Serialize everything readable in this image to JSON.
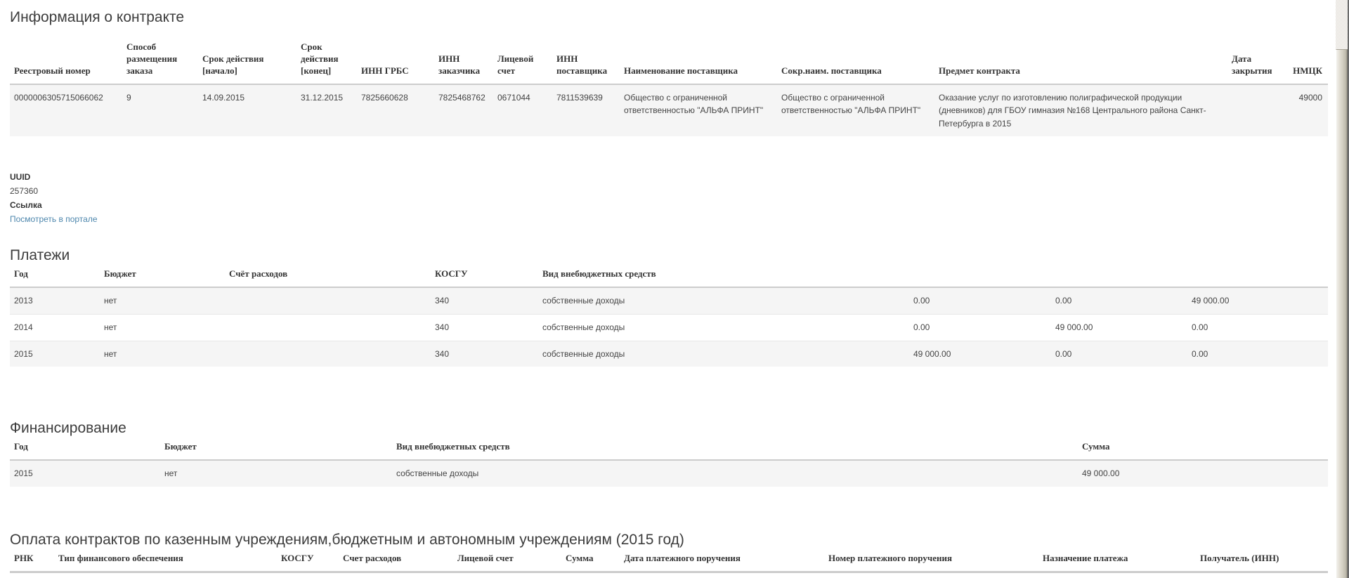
{
  "colors": {
    "link": "#4e87ad"
  },
  "contract_info": {
    "title": "Информация о контракте",
    "columns": [
      "Реестровый номер",
      "Способ размещения заказа",
      "Срок действия [начало]",
      "Срок действия [конец]",
      "ИНН ГРБС",
      "ИНН заказчика",
      "Лицевой счет",
      "ИНН поставщика",
      "Наименование поставщика",
      "Сокр.наим. поставщика",
      "Предмет контракта",
      "Дата закрытия",
      "НМЦК"
    ],
    "row": [
      "0000006305715066062",
      "9",
      "14.09.2015",
      "31.12.2015",
      "7825660628",
      "7825468762",
      "0671044",
      "7811539639",
      "Общество с ограниченной ответственностью \"АЛЬФА ПРИНТ\"",
      "Общество с ограниченной ответственностью \"АЛЬФА ПРИНТ\"",
      "Оказание услуг по изготовлению полиграфической продукции (дневников) для ГБОУ гимназия №168 Центрального района Санкт-Петербурга в 2015",
      "",
      "49000"
    ]
  },
  "uuid": {
    "label": "UUID",
    "value": "257360"
  },
  "link": {
    "label": "Ссылка",
    "text": "Посмотреть в портале"
  },
  "payments": {
    "title": "Платежи",
    "columns": [
      "Год",
      "Бюджет",
      "Счёт расходов",
      "КОСГУ",
      "Вид внебюджетных средств",
      "",
      "",
      ""
    ],
    "rows": [
      [
        "2013",
        "нет",
        "",
        "340",
        "собственные доходы",
        "0.00",
        "0.00",
        "49 000.00"
      ],
      [
        "2014",
        "нет",
        "",
        "340",
        "собственные доходы",
        "0.00",
        "49 000.00",
        "0.00"
      ],
      [
        "2015",
        "нет",
        "",
        "340",
        "собственные доходы",
        "49 000.00",
        "0.00",
        "0.00"
      ]
    ]
  },
  "financing": {
    "title": "Финансирование",
    "columns": [
      "Год",
      "Бюджет",
      "Вид внебюджетных средств",
      "Сумма"
    ],
    "rows": [
      [
        "2015",
        "нет",
        "собственные доходы",
        "49 000.00"
      ]
    ]
  },
  "contract_payment": {
    "title": "Оплата контрактов по казенным учреждениям,бюджетным и автономным учреждениям (2015 год)",
    "columns": [
      "РНК",
      "Тип финансового обеспечения",
      "КОСГУ",
      "Счет расходов",
      "Лицевой счет",
      "Сумма",
      "Дата платежного поручения",
      "Номер платежного поручения",
      "Назначение платежа",
      "Получатель (ИНН)"
    ]
  }
}
